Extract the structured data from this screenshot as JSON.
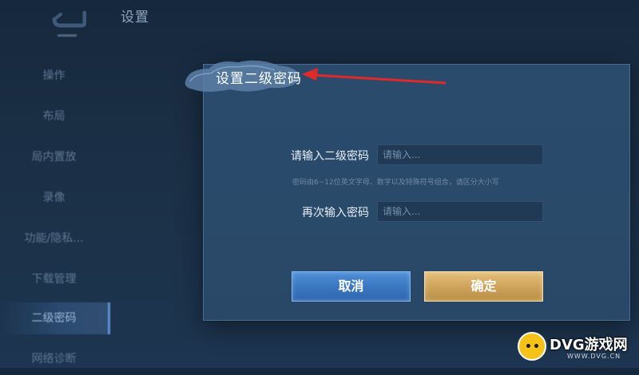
{
  "header": {
    "title": "设置"
  },
  "sidebar": {
    "items": [
      {
        "label": "操作"
      },
      {
        "label": "布局"
      },
      {
        "label": "局内置放"
      },
      {
        "label": "录像"
      },
      {
        "label": "功能/隐私..."
      },
      {
        "label": "下载管理"
      },
      {
        "label": "二级密码",
        "active": true
      },
      {
        "label": "网络诊断"
      }
    ]
  },
  "dialog": {
    "title": "设置二级密码",
    "field1_label": "请输入二级密码",
    "field1_placeholder": "请输入...",
    "hint": "密码由6~12位英文字母、数字以及特殊符号组合，请区分大小写",
    "field2_label": "再次输入密码",
    "field2_placeholder": "请输入...",
    "cancel_label": "取消",
    "confirm_label": "确定"
  },
  "watermark": {
    "name": "DVG游戏网",
    "url": "WWW.DVG.CN"
  },
  "colors": {
    "cancel_button": "#3b78c2",
    "confirm_button": "#cfa55d",
    "annotation_arrow": "#e02a2a"
  }
}
